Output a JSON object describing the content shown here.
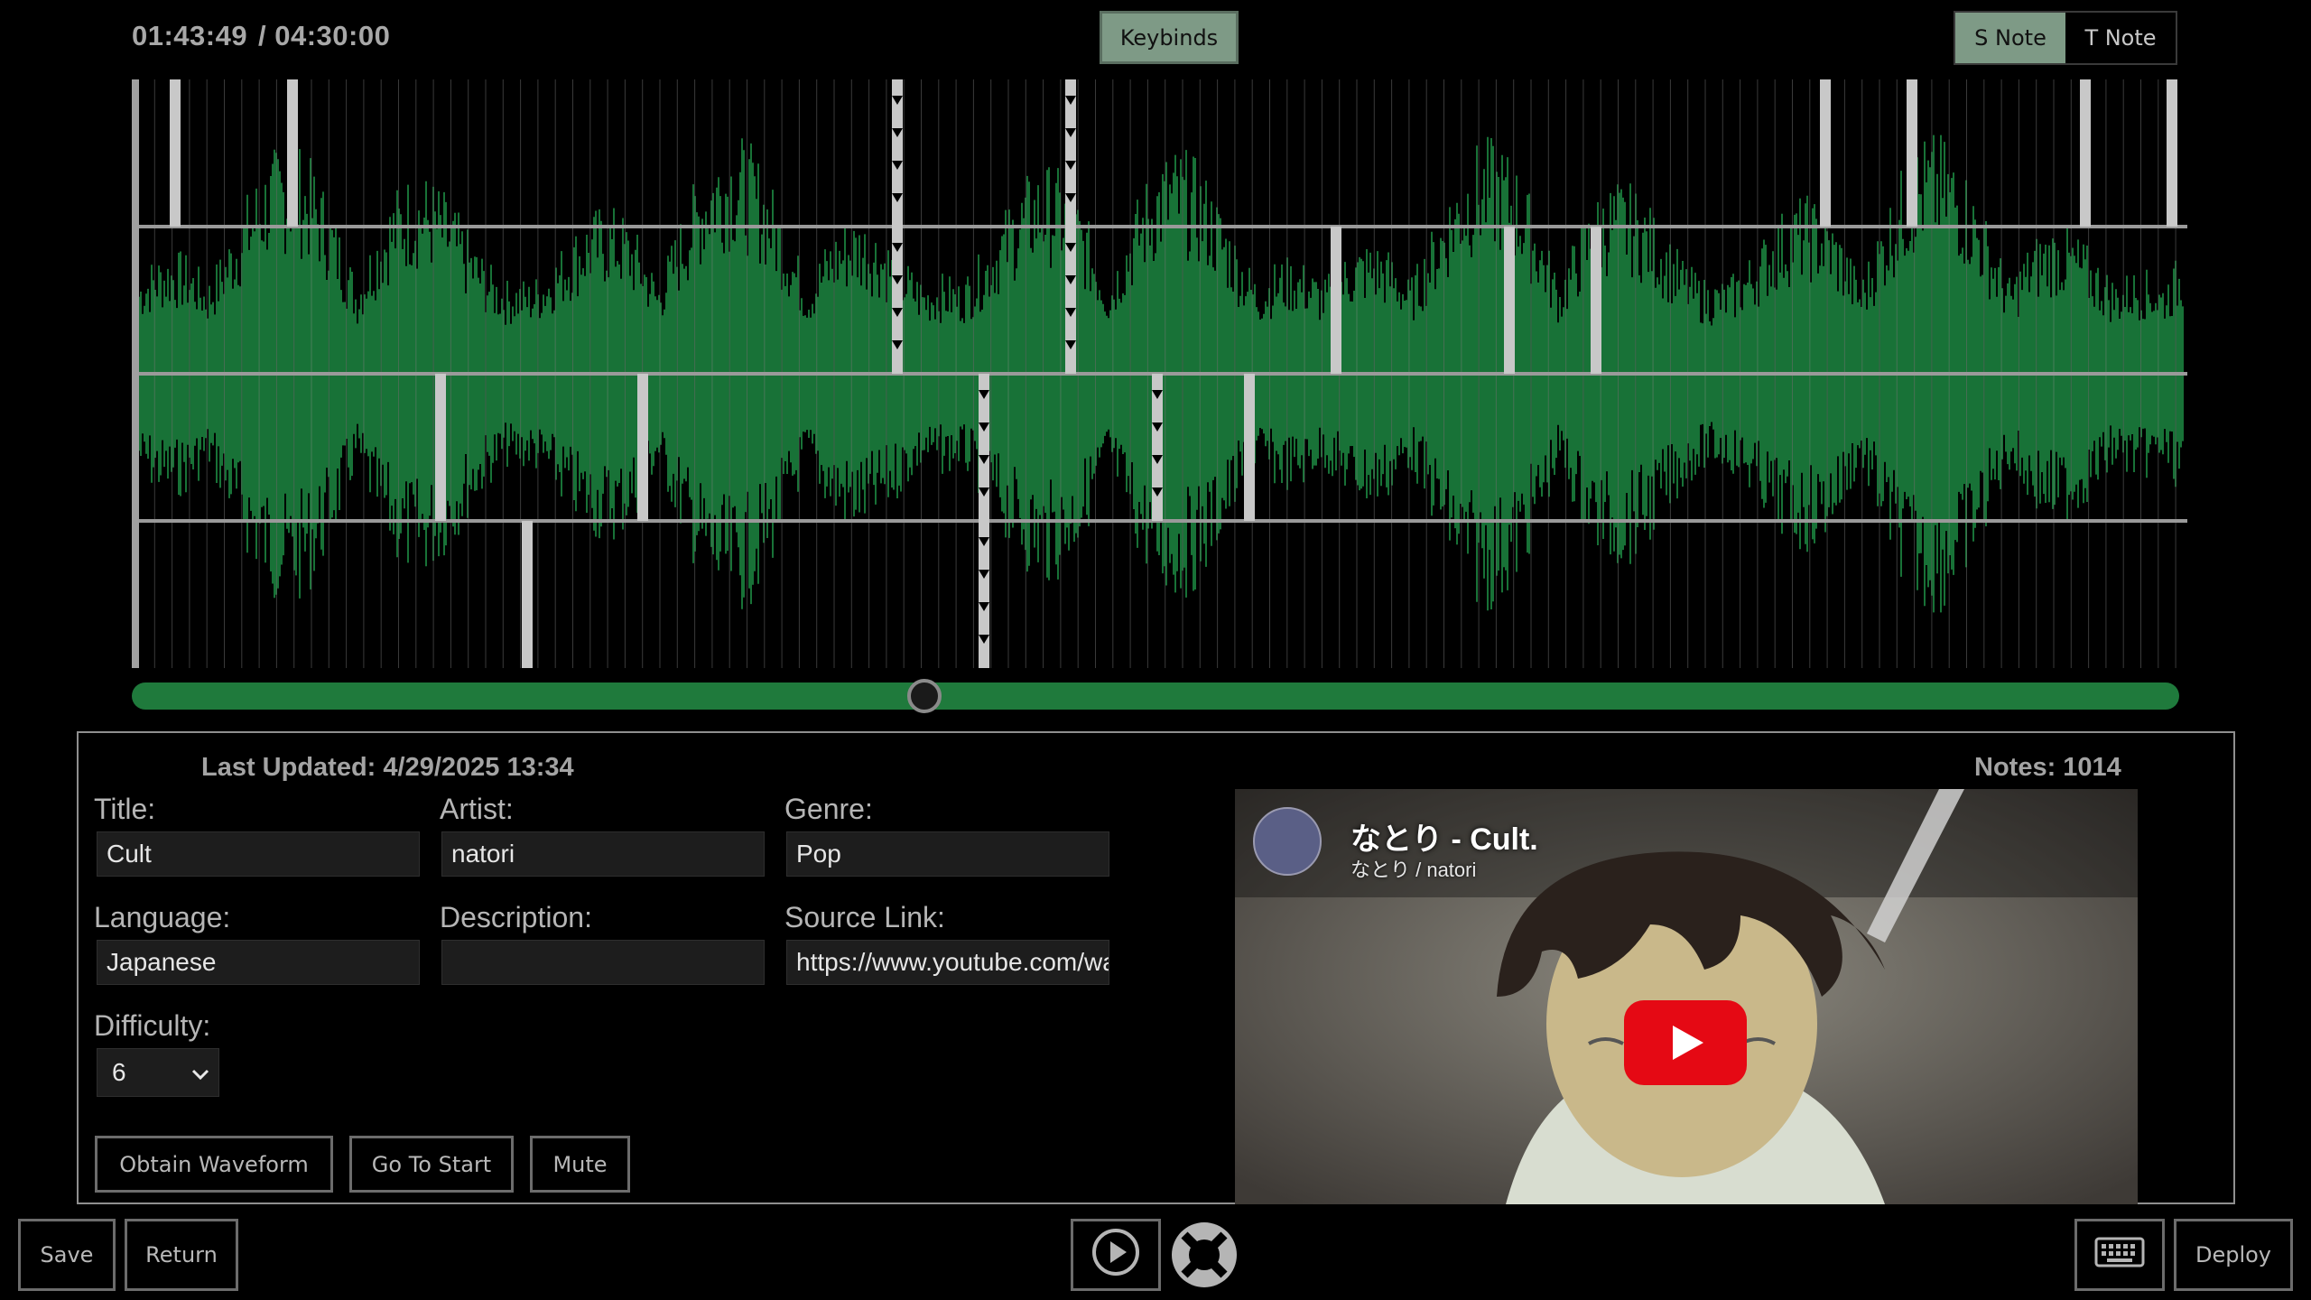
{
  "header": {
    "current_time": "01:43:49",
    "total_time": "/ 04:30:00",
    "keybinds_label": "Keybinds",
    "s_note_label": "S Note",
    "t_note_label": "T Note",
    "selected_mode": "S Note"
  },
  "timeline": {
    "lanes": 4,
    "playhead_fraction": 0.387,
    "waveform_color": "#1f8f45",
    "note_color": "#c8c8c8"
  },
  "info": {
    "last_updated": "Last Updated: 4/29/2025 13:34",
    "notes_count": "Notes: 1014"
  },
  "form": {
    "title_label": "Title:",
    "title_value": "Cult",
    "artist_label": "Artist:",
    "artist_value": "natori",
    "genre_label": "Genre:",
    "genre_value": "Pop",
    "language_label": "Language:",
    "language_value": "Japanese",
    "description_label": "Description:",
    "description_value": "",
    "source_label": "Source Link:",
    "source_value": "https://www.youtube.com/wa",
    "difficulty_label": "Difficulty:",
    "difficulty_value": "6"
  },
  "actions": {
    "obtain_waveform": "Obtain Waveform",
    "go_to_start": "Go To Start",
    "mute": "Mute"
  },
  "video": {
    "title": "なとり - Cult.",
    "channel": "なとり / natori"
  },
  "footer": {
    "save": "Save",
    "return": "Return",
    "deploy": "Deploy"
  }
}
